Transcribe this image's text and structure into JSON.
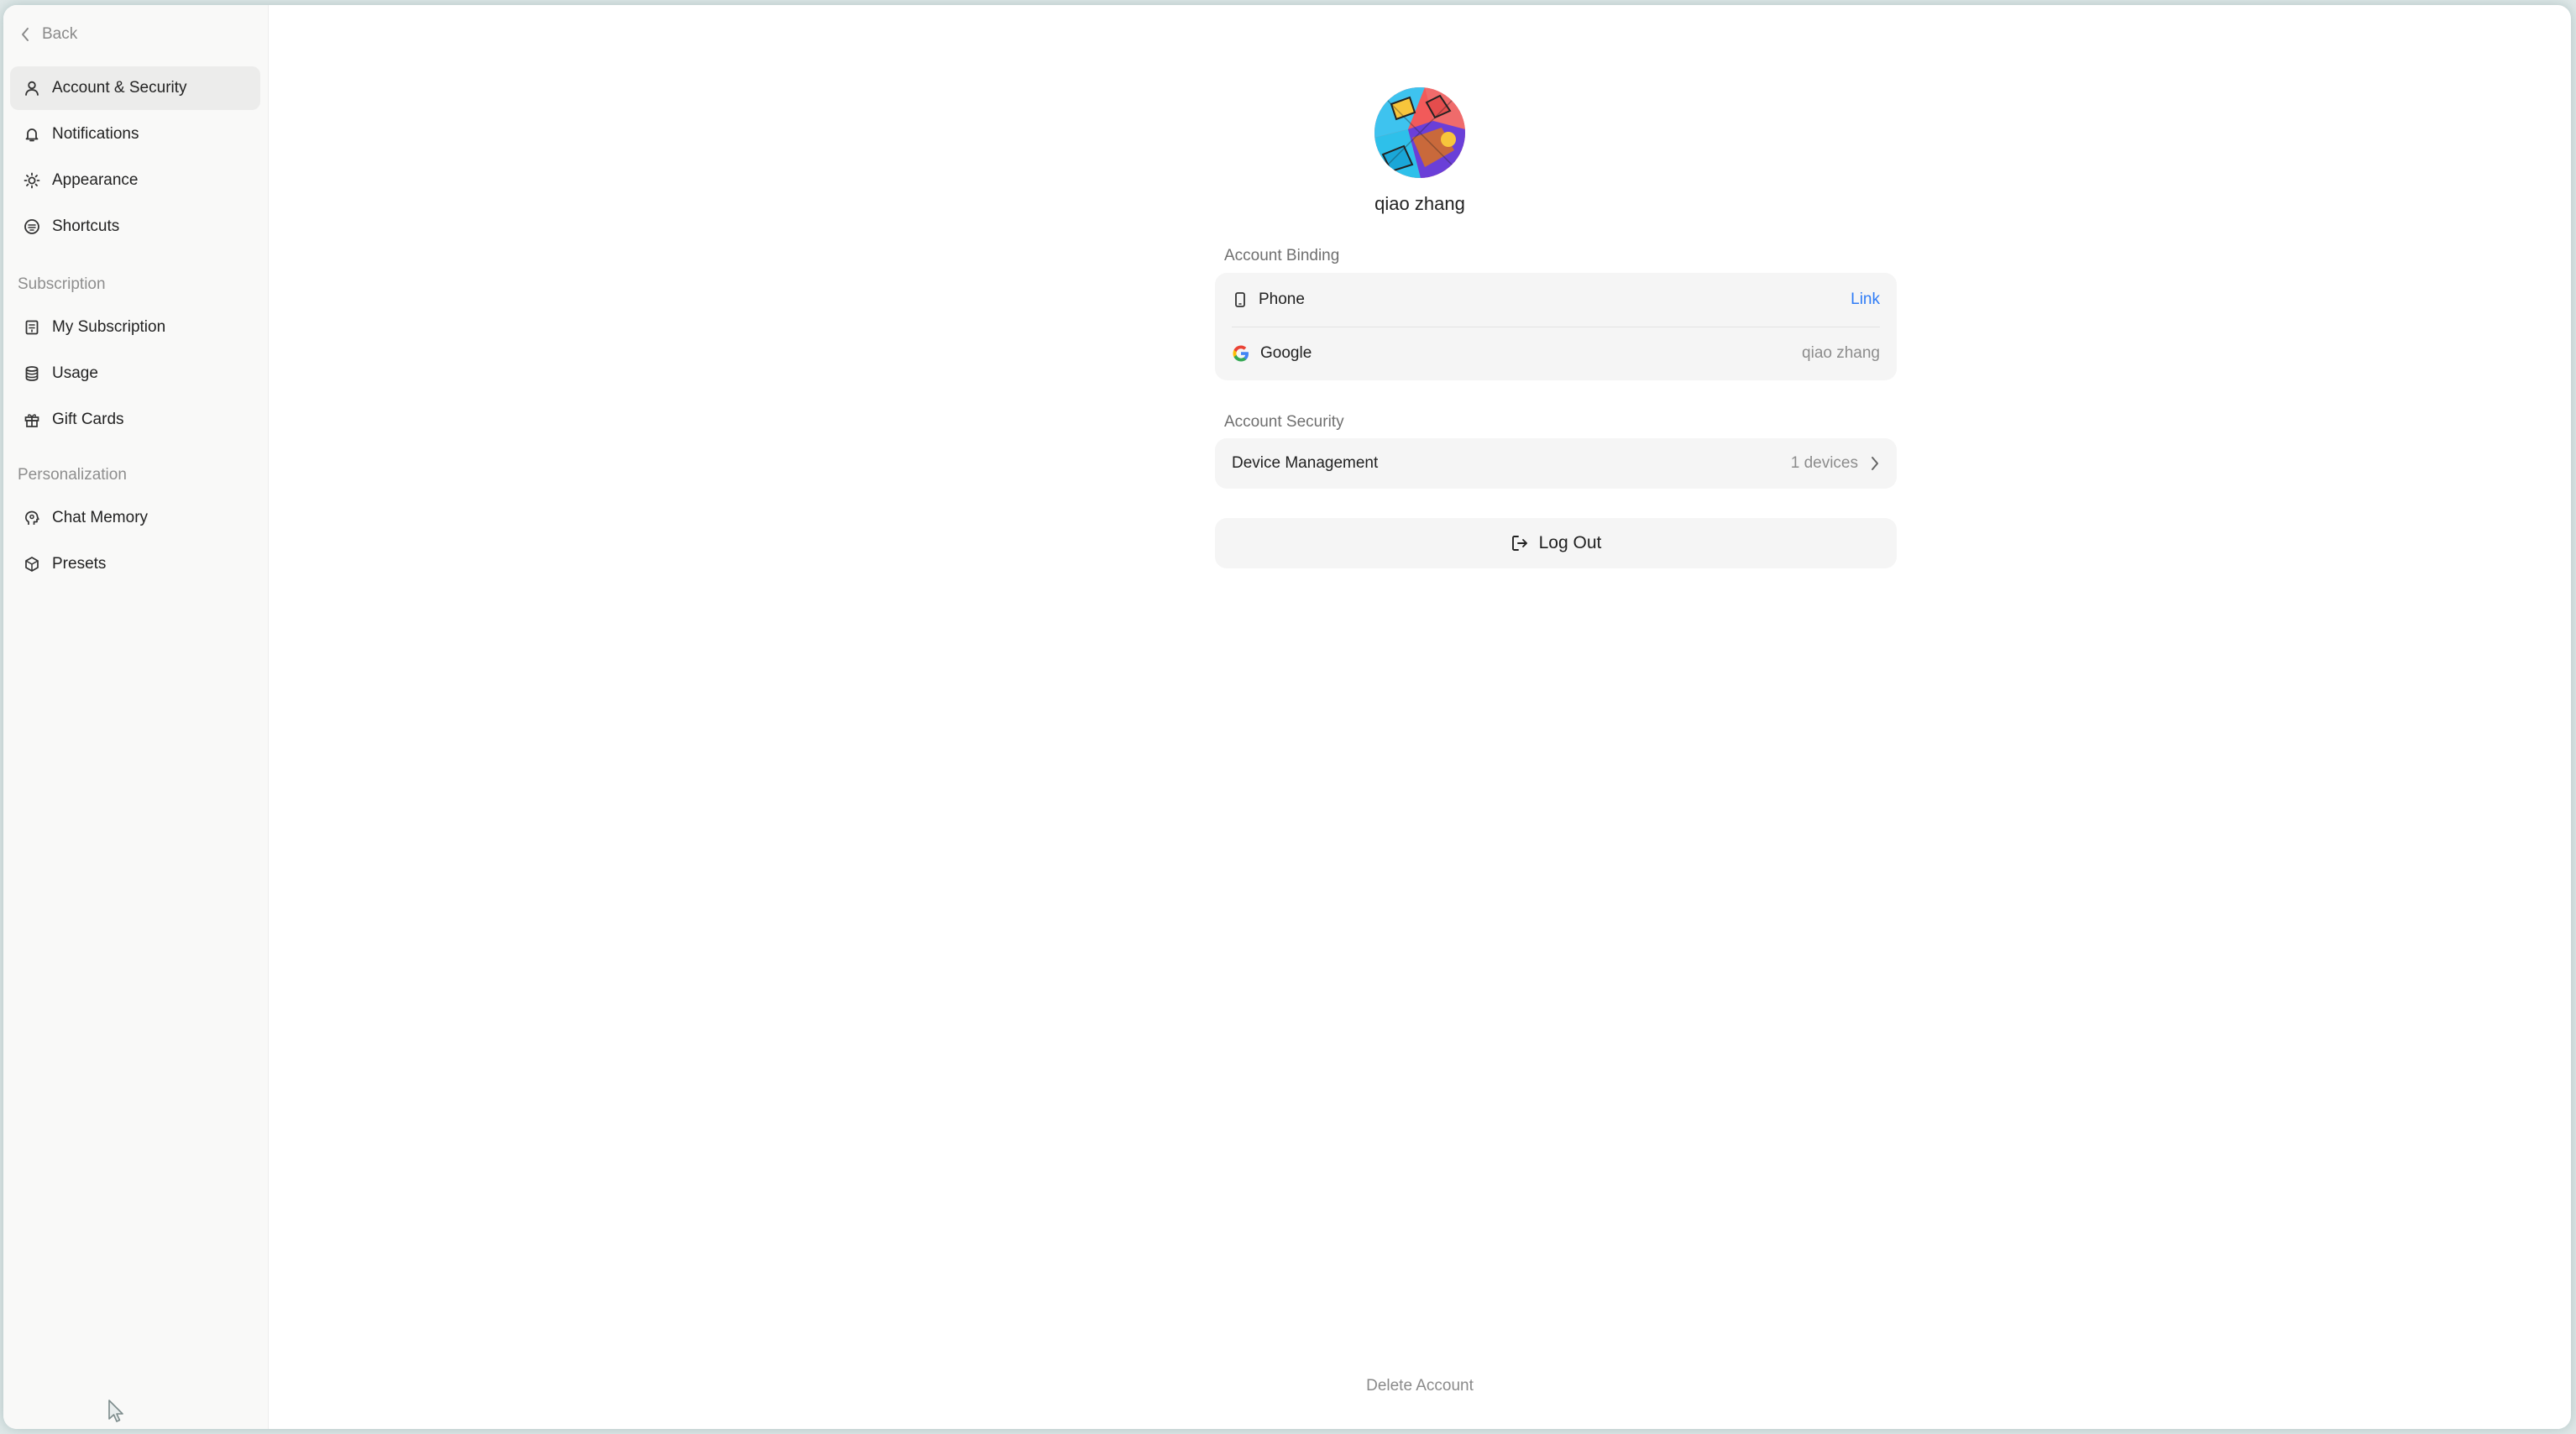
{
  "sidebar": {
    "back_label": "Back",
    "items": [
      {
        "label": "Account & Security",
        "icon": "user-icon"
      },
      {
        "label": "Notifications",
        "icon": "bell-icon"
      },
      {
        "label": "Appearance",
        "icon": "sun-icon"
      },
      {
        "label": "Shortcuts",
        "icon": "command-icon"
      }
    ],
    "subscription_label": "Subscription",
    "subscription_items": [
      {
        "label": "My Subscription",
        "icon": "receipt-icon"
      },
      {
        "label": "Usage",
        "icon": "database-icon"
      },
      {
        "label": "Gift Cards",
        "icon": "gift-icon"
      }
    ],
    "personalization_label": "Personalization",
    "personalization_items": [
      {
        "label": "Chat Memory",
        "icon": "memory-icon"
      },
      {
        "label": "Presets",
        "icon": "cube-icon"
      }
    ]
  },
  "profile": {
    "username": "qiao zhang"
  },
  "account_binding": {
    "label": "Account Binding",
    "phone_label": "Phone",
    "phone_action": "Link",
    "google_label": "Google",
    "google_value": "qiao zhang"
  },
  "account_security": {
    "label": "Account Security",
    "device_label": "Device Management",
    "device_count": "1 devices"
  },
  "actions": {
    "logout_label": "Log Out",
    "delete_label": "Delete Account"
  },
  "colors": {
    "accent_link": "#2f7cf6",
    "sidebar_bg": "#f9f9f8",
    "card_bg": "#f5f5f5"
  }
}
